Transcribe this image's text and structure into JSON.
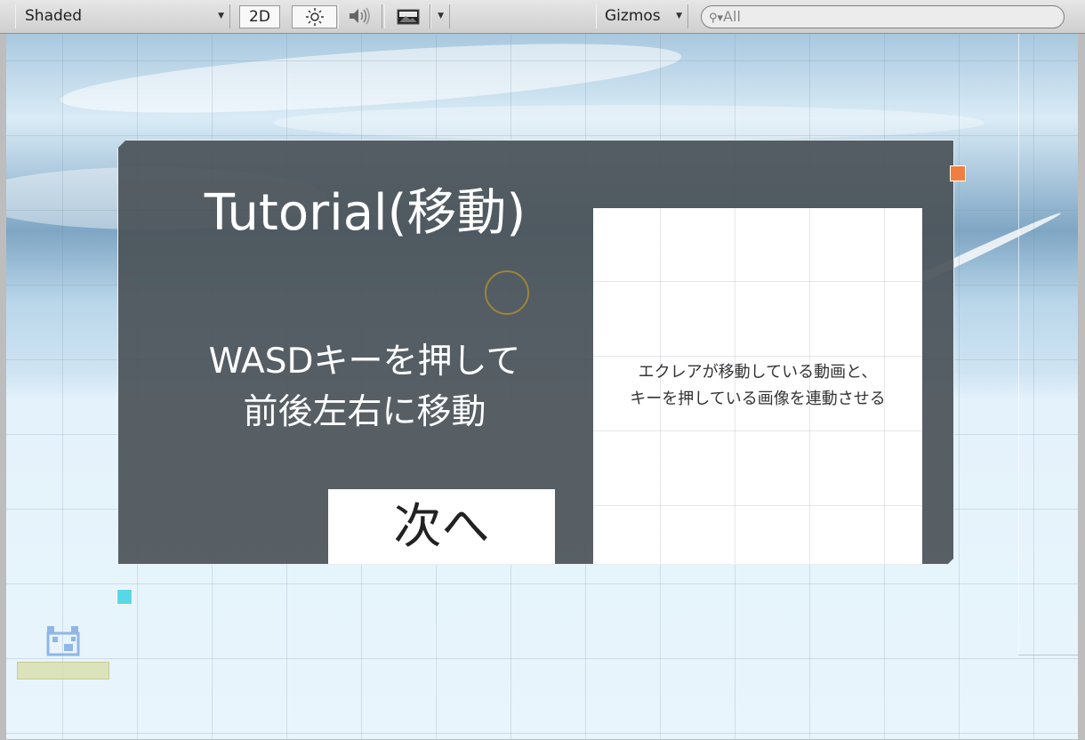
{
  "toolbar": {
    "shading_mode": "Shaded",
    "mode_2d": "2D",
    "lighting_icon": "sun-icon",
    "audio_icon": "speaker-icon",
    "effects_icon": "image-icon",
    "gizmos_label": "Gizmos",
    "search_placeholder": "All"
  },
  "tutorial": {
    "title": "Tutorial(移動)",
    "description_line1": "WASDキーを押して",
    "description_line2": "前後左右に移動",
    "next_button": "次へ",
    "preview_line1": "エクレアが移動している動画と、",
    "preview_line2": "キーを押している画像を連動させる"
  },
  "colors": {
    "panel_bg": "#4b5258",
    "handle_orange": "#f07f3f",
    "handle_cyan": "#58d8e6",
    "label_yellow": "#d7dea9"
  }
}
